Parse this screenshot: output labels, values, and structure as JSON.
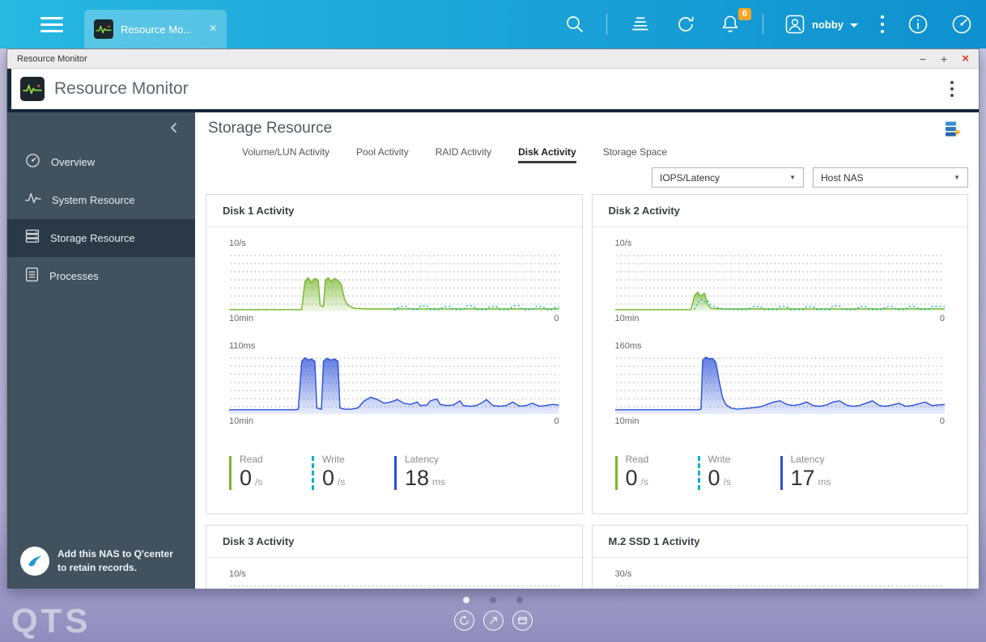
{
  "taskbar": {
    "tab_title": "Resource Mo...",
    "notification_count": "6",
    "username": "nobby"
  },
  "window": {
    "titlebar_title": "Resource Monitor",
    "header_title": "Resource Monitor"
  },
  "sidebar": {
    "items": [
      {
        "label": "Overview"
      },
      {
        "label": "System Resource"
      },
      {
        "label": "Storage Resource"
      },
      {
        "label": "Processes"
      }
    ],
    "active_item": "Storage Resource",
    "qcenter_line1": "Add this NAS to Q'center",
    "qcenter_line2": "to retain records."
  },
  "main": {
    "title": "Storage Resource",
    "tabs": [
      {
        "label": "Volume/LUN Activity"
      },
      {
        "label": "Pool Activity"
      },
      {
        "label": "RAID Activity"
      },
      {
        "label": "Disk Activity"
      },
      {
        "label": "Storage Space"
      }
    ],
    "active_tab": "Disk Activity",
    "filter_metric": "IOPS/Latency",
    "filter_target": "Host NAS"
  },
  "cards": [
    {
      "title": "Disk 1 Activity",
      "iops_max": "10/s",
      "iops_xmin": "10min",
      "iops_xmax": "0",
      "lat_max": "110ms",
      "lat_xmin": "10min",
      "lat_xmax": "0",
      "read_label": "Read",
      "read_value": "0",
      "read_unit": "/s",
      "write_label": "Write",
      "write_value": "0",
      "write_unit": "/s",
      "latency_label": "Latency",
      "latency_value": "18",
      "latency_unit": "ms"
    },
    {
      "title": "Disk 2 Activity",
      "iops_max": "10/s",
      "iops_xmin": "10min",
      "iops_xmax": "0",
      "lat_max": "160ms",
      "lat_xmin": "10min",
      "lat_xmax": "0",
      "read_label": "Read",
      "read_value": "0",
      "read_unit": "/s",
      "write_label": "Write",
      "write_value": "0",
      "write_unit": "/s",
      "latency_label": "Latency",
      "latency_value": "17",
      "latency_unit": "ms"
    },
    {
      "title": "Disk 3 Activity",
      "iops_max": "10/s"
    },
    {
      "title": "M.2 SSD 1 Activity",
      "iops_max": "30/s"
    }
  ],
  "icons": {
    "minimize": "−",
    "maximize": "+",
    "close": "×",
    "tab_close": "×",
    "caret_down": "▼"
  },
  "colors": {
    "taskbar_start": "#28b8e0",
    "taskbar_end": "#0f90cf",
    "badge_orange": "#f5a623",
    "sidebar": "#42515e",
    "sidebar_active": "#2b3845",
    "read_green": "#76b82a",
    "write_teal": "#00b5c4",
    "latency_blue": "#2b50d8"
  },
  "desktop": {
    "logo": "QTS"
  },
  "chart_data": [
    {
      "type": "area",
      "target": "d1-iops",
      "title": "Disk 1 Activity - IOPS",
      "ylabel": "IOPS",
      "y_max": 10,
      "y_max_label": "10/s",
      "x_window": "10min",
      "x_end": "0",
      "note": "point y values are percent of y_max",
      "series": [
        {
          "name": "Read",
          "color": "#76b82a",
          "fill": true,
          "dashed": false,
          "points": [
            [
              0,
              3
            ],
            [
              22,
              3
            ],
            [
              23,
              50
            ],
            [
              24,
              56
            ],
            [
              25,
              48
            ],
            [
              26,
              55
            ],
            [
              27,
              52
            ],
            [
              27.6,
              10
            ],
            [
              28.6,
              8
            ],
            [
              29.2,
              52
            ],
            [
              30,
              56
            ],
            [
              31,
              50
            ],
            [
              32,
              55
            ],
            [
              33,
              52
            ],
            [
              34,
              45
            ],
            [
              35,
              20
            ],
            [
              36,
              10
            ],
            [
              38,
              5
            ],
            [
              42,
              4
            ],
            [
              100,
              4
            ]
          ]
        },
        {
          "name": "Write",
          "color": "#00b5c4",
          "fill": false,
          "dashed": true,
          "points": [
            [
              50,
              2
            ],
            [
              52,
              8
            ],
            [
              54,
              8
            ],
            [
              55,
              3
            ],
            [
              57,
              3
            ],
            [
              58,
              9
            ],
            [
              60,
              9
            ],
            [
              61,
              3
            ],
            [
              64,
              3
            ],
            [
              65,
              8
            ],
            [
              67,
              8
            ],
            [
              68,
              3
            ],
            [
              71,
              3
            ],
            [
              72,
              9
            ],
            [
              74,
              9
            ],
            [
              75,
              3
            ],
            [
              78,
              3
            ],
            [
              79,
              8
            ],
            [
              81,
              8
            ],
            [
              82,
              3
            ],
            [
              85,
              3
            ],
            [
              86,
              9
            ],
            [
              88,
              9
            ],
            [
              89,
              3
            ],
            [
              92,
              3
            ],
            [
              93,
              8
            ],
            [
              95,
              8
            ],
            [
              96,
              3
            ],
            [
              98,
              3
            ],
            [
              99,
              7
            ],
            [
              100,
              7
            ]
          ]
        }
      ]
    },
    {
      "type": "area",
      "target": "d1-lat",
      "title": "Disk 1 Activity - Latency",
      "ylabel": "Latency",
      "y_max": 110,
      "y_max_label": "110ms",
      "x_window": "10min",
      "x_end": "0",
      "series": [
        {
          "name": "Latency",
          "color": "#2b50d8",
          "fill": true,
          "dashed": false,
          "points": [
            [
              0,
              7
            ],
            [
              20,
              7
            ],
            [
              21,
              8
            ],
            [
              22,
              88
            ],
            [
              23,
              94
            ],
            [
              24,
              90
            ],
            [
              25,
              92
            ],
            [
              26,
              88
            ],
            [
              26.6,
              10
            ],
            [
              28,
              8
            ],
            [
              28.6,
              88
            ],
            [
              29.6,
              93
            ],
            [
              31,
              90
            ],
            [
              32,
              92
            ],
            [
              33,
              88
            ],
            [
              33.6,
              10
            ],
            [
              35,
              8
            ],
            [
              37,
              8
            ],
            [
              39,
              10
            ],
            [
              41,
              22
            ],
            [
              43,
              28
            ],
            [
              45,
              24
            ],
            [
              47,
              18
            ],
            [
              49,
              20
            ],
            [
              51,
              24
            ],
            [
              53,
              18
            ],
            [
              55,
              16
            ],
            [
              57,
              20
            ],
            [
              58,
              14
            ],
            [
              60,
              15
            ],
            [
              61,
              22
            ],
            [
              63,
              25
            ],
            [
              64,
              16
            ],
            [
              66,
              14
            ],
            [
              68,
              15
            ],
            [
              70,
              22
            ],
            [
              71,
              14
            ],
            [
              73,
              13
            ],
            [
              75,
              14
            ],
            [
              77,
              20
            ],
            [
              78,
              24
            ],
            [
              80,
              14
            ],
            [
              82,
              13
            ],
            [
              84,
              14
            ],
            [
              86,
              20
            ],
            [
              88,
              13
            ],
            [
              90,
              14
            ],
            [
              92,
              18
            ],
            [
              94,
              13
            ],
            [
              96,
              14
            ],
            [
              98,
              16
            ],
            [
              100,
              15
            ]
          ]
        }
      ]
    },
    {
      "type": "area",
      "target": "d2-iops",
      "title": "Disk 2 Activity - IOPS",
      "ylabel": "IOPS",
      "y_max": 10,
      "y_max_label": "10/s",
      "x_window": "10min",
      "x_end": "0",
      "series": [
        {
          "name": "Read",
          "color": "#76b82a",
          "fill": true,
          "dashed": false,
          "points": [
            [
              0,
              3
            ],
            [
              23,
              3
            ],
            [
              24,
              26
            ],
            [
              25,
              32
            ],
            [
              26,
              25
            ],
            [
              27,
              30
            ],
            [
              28,
              12
            ],
            [
              29,
              5
            ],
            [
              31,
              4
            ],
            [
              100,
              4
            ]
          ]
        },
        {
          "name": "Write",
          "color": "#00b5c4",
          "fill": false,
          "dashed": true,
          "points": [
            [
              24,
              3
            ],
            [
              25,
              14
            ],
            [
              26,
              20
            ],
            [
              27,
              15
            ],
            [
              28,
              18
            ],
            [
              29,
              10
            ],
            [
              31,
              6
            ],
            [
              33,
              4
            ],
            [
              36,
              3
            ],
            [
              40,
              3
            ],
            [
              42,
              8
            ],
            [
              44,
              8
            ],
            [
              45,
              3
            ],
            [
              49,
              3
            ],
            [
              50,
              8
            ],
            [
              52,
              8
            ],
            [
              53,
              3
            ],
            [
              57,
              3
            ],
            [
              58,
              8
            ],
            [
              60,
              8
            ],
            [
              61,
              3
            ],
            [
              65,
              3
            ],
            [
              66,
              9
            ],
            [
              68,
              9
            ],
            [
              69,
              3
            ],
            [
              73,
              3
            ],
            [
              74,
              8
            ],
            [
              76,
              8
            ],
            [
              77,
              3
            ],
            [
              81,
              3
            ],
            [
              82,
              8
            ],
            [
              84,
              8
            ],
            [
              85,
              3
            ],
            [
              88,
              3
            ],
            [
              89,
              8
            ],
            [
              91,
              8
            ],
            [
              92,
              3
            ],
            [
              95,
              3
            ],
            [
              96,
              8
            ],
            [
              98,
              8
            ],
            [
              100,
              8
            ]
          ]
        }
      ]
    },
    {
      "type": "area",
      "target": "d2-lat",
      "title": "Disk 2 Activity - Latency",
      "ylabel": "Latency",
      "y_max": 160,
      "y_max_label": "160ms",
      "x_window": "10min",
      "x_end": "0",
      "series": [
        {
          "name": "Latency",
          "color": "#2b50d8",
          "fill": true,
          "dashed": false,
          "points": [
            [
              0,
              7
            ],
            [
              25,
              7
            ],
            [
              26,
              8
            ],
            [
              26.5,
              90
            ],
            [
              27.5,
              95
            ],
            [
              28.5,
              92
            ],
            [
              29.5,
              93
            ],
            [
              30.5,
              86
            ],
            [
              31.5,
              55
            ],
            [
              32.5,
              28
            ],
            [
              33.5,
              16
            ],
            [
              35,
              10
            ],
            [
              37,
              8
            ],
            [
              39,
              9
            ],
            [
              41,
              10
            ],
            [
              44,
              12
            ],
            [
              46,
              16
            ],
            [
              48,
              20
            ],
            [
              50,
              22
            ],
            [
              52,
              16
            ],
            [
              54,
              14
            ],
            [
              56,
              16
            ],
            [
              58,
              20
            ],
            [
              60,
              14
            ],
            [
              62,
              13
            ],
            [
              64,
              15
            ],
            [
              66,
              20
            ],
            [
              68,
              22
            ],
            [
              70,
              15
            ],
            [
              72,
              13
            ],
            [
              74,
              14
            ],
            [
              76,
              18
            ],
            [
              78,
              22
            ],
            [
              80,
              14
            ],
            [
              82,
              13
            ],
            [
              84,
              15
            ],
            [
              86,
              18
            ],
            [
              88,
              13
            ],
            [
              90,
              14
            ],
            [
              92,
              17
            ],
            [
              94,
              20
            ],
            [
              96,
              14
            ],
            [
              98,
              15
            ],
            [
              100,
              16
            ]
          ]
        }
      ]
    }
  ]
}
